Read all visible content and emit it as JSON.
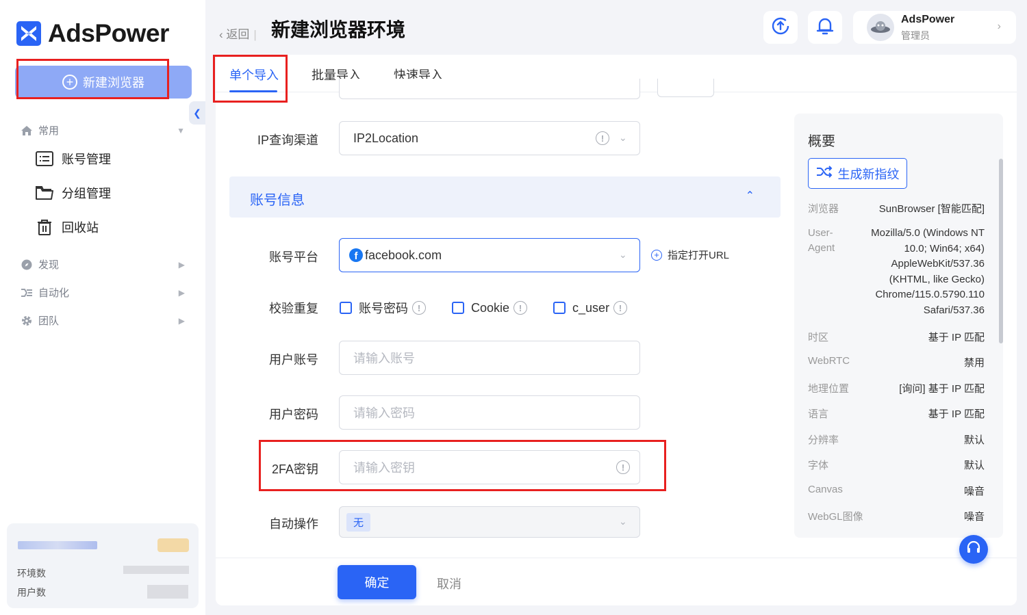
{
  "app": {
    "name": "AdsPower"
  },
  "sidebar": {
    "new_browser_label": "新建浏览器",
    "groups": [
      {
        "label": "常用",
        "icon": "home-icon"
      },
      {
        "label": "发现",
        "icon": "compass-icon"
      },
      {
        "label": "自动化",
        "icon": "automation-icon"
      },
      {
        "label": "团队",
        "icon": "gear-icon"
      }
    ],
    "items": [
      {
        "label": "账号管理",
        "icon": "list-icon"
      },
      {
        "label": "分组管理",
        "icon": "folder-icon"
      },
      {
        "label": "回收站",
        "icon": "trash-icon"
      }
    ],
    "stats": {
      "env_label": "环境数",
      "user_label": "用户数"
    }
  },
  "header": {
    "back_label": "返回",
    "title": "新建浏览器环境",
    "user_name": "AdsPower",
    "user_role": "管理员"
  },
  "tabs": [
    {
      "label": "单个导入",
      "active": true
    },
    {
      "label": "批量导入",
      "active": false
    },
    {
      "label": "快速导入",
      "active": false
    }
  ],
  "form": {
    "ip_channel": {
      "label": "IP查询渠道",
      "value": "IP2Location"
    },
    "section_title": "账号信息",
    "platform": {
      "label": "账号平台",
      "value": "facebook.com",
      "open_url_label": "指定打开URL"
    },
    "dedupe": {
      "label": "校验重复",
      "options": [
        "账号密码",
        "Cookie",
        "c_user"
      ]
    },
    "account": {
      "label": "用户账号",
      "placeholder": "请输入账号"
    },
    "password": {
      "label": "用户密码",
      "placeholder": "请输入密码"
    },
    "twofa": {
      "label": "2FA密钥",
      "placeholder": "请输入密钥"
    },
    "auto_action": {
      "label": "自动操作",
      "value": "无"
    }
  },
  "footer": {
    "ok_label": "确定",
    "cancel_label": "取消"
  },
  "summary": {
    "title": "概要",
    "generate_label": "生成新指纹",
    "rows": [
      {
        "k": "浏览器",
        "v": "SunBrowser [智能匹配]"
      },
      {
        "k": "User-Agent",
        "v": "Mozilla/5.0 (Windows NT 10.0; Win64; x64) AppleWebKit/537.36 (KHTML, like Gecko) Chrome/115.0.5790.110 Safari/537.36"
      },
      {
        "k": "时区",
        "v": "基于 IP 匹配"
      },
      {
        "k": "WebRTC",
        "v": "禁用"
      },
      {
        "k": "地理位置",
        "v": "[询问] 基于 IP 匹配"
      },
      {
        "k": "语言",
        "v": "基于 IP 匹配"
      },
      {
        "k": "分辨率",
        "v": "默认"
      },
      {
        "k": "字体",
        "v": "默认"
      },
      {
        "k": "Canvas",
        "v": "噪音"
      },
      {
        "k": "WebGL图像",
        "v": "噪音"
      }
    ]
  },
  "colors": {
    "accent": "#2a64f5",
    "highlight": "#e8201f"
  }
}
